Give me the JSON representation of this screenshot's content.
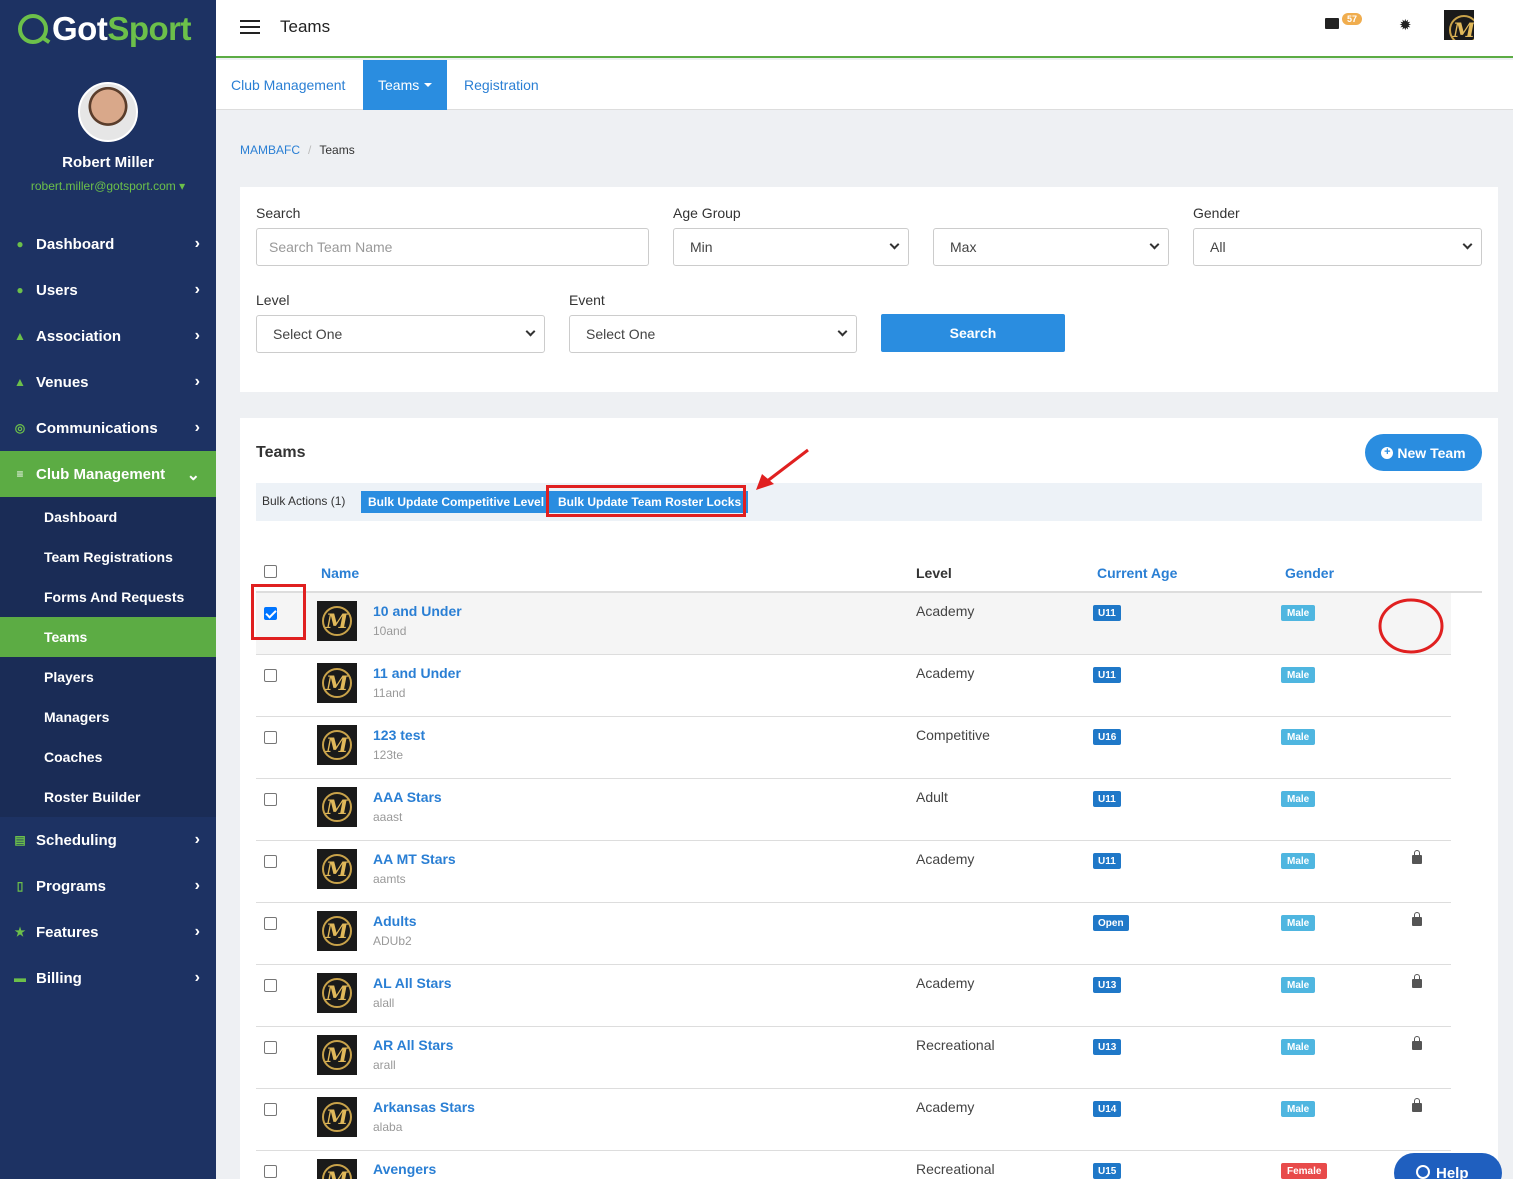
{
  "brand": {
    "name_part1": "Got",
    "name_part2": "Sport"
  },
  "user": {
    "name": "Robert Miller",
    "email": "robert.miller@gotsport.com"
  },
  "sidebar": {
    "items": [
      {
        "label": "Dashboard",
        "icon": "dashboard-icon"
      },
      {
        "label": "Users",
        "icon": "users-icon"
      },
      {
        "label": "Association",
        "icon": "sitemap-icon"
      },
      {
        "label": "Venues",
        "icon": "home-icon"
      },
      {
        "label": "Communications",
        "icon": "chat-icon"
      },
      {
        "label": "Club Management",
        "icon": "list-icon"
      }
    ],
    "sub_items": [
      "Dashboard",
      "Team Registrations",
      "Forms And Requests",
      "Teams",
      "Players",
      "Managers",
      "Coaches",
      "Roster Builder"
    ],
    "lower_items": [
      {
        "label": "Scheduling",
        "icon": "calendar-icon"
      },
      {
        "label": "Programs",
        "icon": "file-icon"
      },
      {
        "label": "Features",
        "icon": "star-icon"
      },
      {
        "label": "Billing",
        "icon": "card-icon"
      }
    ]
  },
  "header": {
    "title": "Teams",
    "mail_count": "57"
  },
  "tabs": [
    "Club Management",
    "Teams",
    "Registration"
  ],
  "breadcrumb": {
    "link": "MAMBAFC",
    "current": "Teams"
  },
  "filters": {
    "search_label": "Search",
    "search_placeholder": "Search Team Name",
    "age_group_label": "Age Group",
    "age_min": "Min",
    "age_max": "Max",
    "gender_label": "Gender",
    "gender_value": "All",
    "level_label": "Level",
    "level_value": "Select One",
    "event_label": "Event",
    "event_value": "Select One",
    "search_button": "Search"
  },
  "teams_panel": {
    "title": "Teams",
    "new_team_button": "New Team",
    "bulk_label": "Bulk Actions (1)",
    "bulk_update_level": "Bulk Update Competitive Level",
    "bulk_update_locks": "Bulk Update Team Roster Locks"
  },
  "table": {
    "headers": {
      "name": "Name",
      "level": "Level",
      "current_age": "Current Age",
      "gender": "Gender"
    },
    "rows": [
      {
        "name": "10 and Under",
        "code": "10and",
        "level": "Academy",
        "age": "U11",
        "gender": "Male",
        "checked": true,
        "locked": false
      },
      {
        "name": "11 and Under",
        "code": "11and",
        "level": "Academy",
        "age": "U11",
        "gender": "Male",
        "checked": false,
        "locked": false
      },
      {
        "name": "123 test",
        "code": "123te",
        "level": "Competitive",
        "age": "U16",
        "gender": "Male",
        "checked": false,
        "locked": false
      },
      {
        "name": "AAA Stars",
        "code": "aaast",
        "level": "Adult",
        "age": "U11",
        "gender": "Male",
        "checked": false,
        "locked": false
      },
      {
        "name": "AA MT Stars",
        "code": "aamts",
        "level": "Academy",
        "age": "U11",
        "gender": "Male",
        "checked": false,
        "locked": true
      },
      {
        "name": "Adults",
        "code": "ADUb2",
        "level": "",
        "age": "Open",
        "gender": "Male",
        "checked": false,
        "locked": true
      },
      {
        "name": "AL All Stars",
        "code": "alall",
        "level": "Academy",
        "age": "U13",
        "gender": "Male",
        "checked": false,
        "locked": true
      },
      {
        "name": "AR All Stars",
        "code": "arall",
        "level": "Recreational",
        "age": "U13",
        "gender": "Male",
        "checked": false,
        "locked": true
      },
      {
        "name": "Arkansas Stars",
        "code": "alaba",
        "level": "Academy",
        "age": "U14",
        "gender": "Male",
        "checked": false,
        "locked": true
      },
      {
        "name": "Avengers",
        "code": "",
        "level": "Recreational",
        "age": "U15",
        "gender": "Female",
        "checked": false,
        "locked": false
      }
    ]
  },
  "help_button": "Help"
}
